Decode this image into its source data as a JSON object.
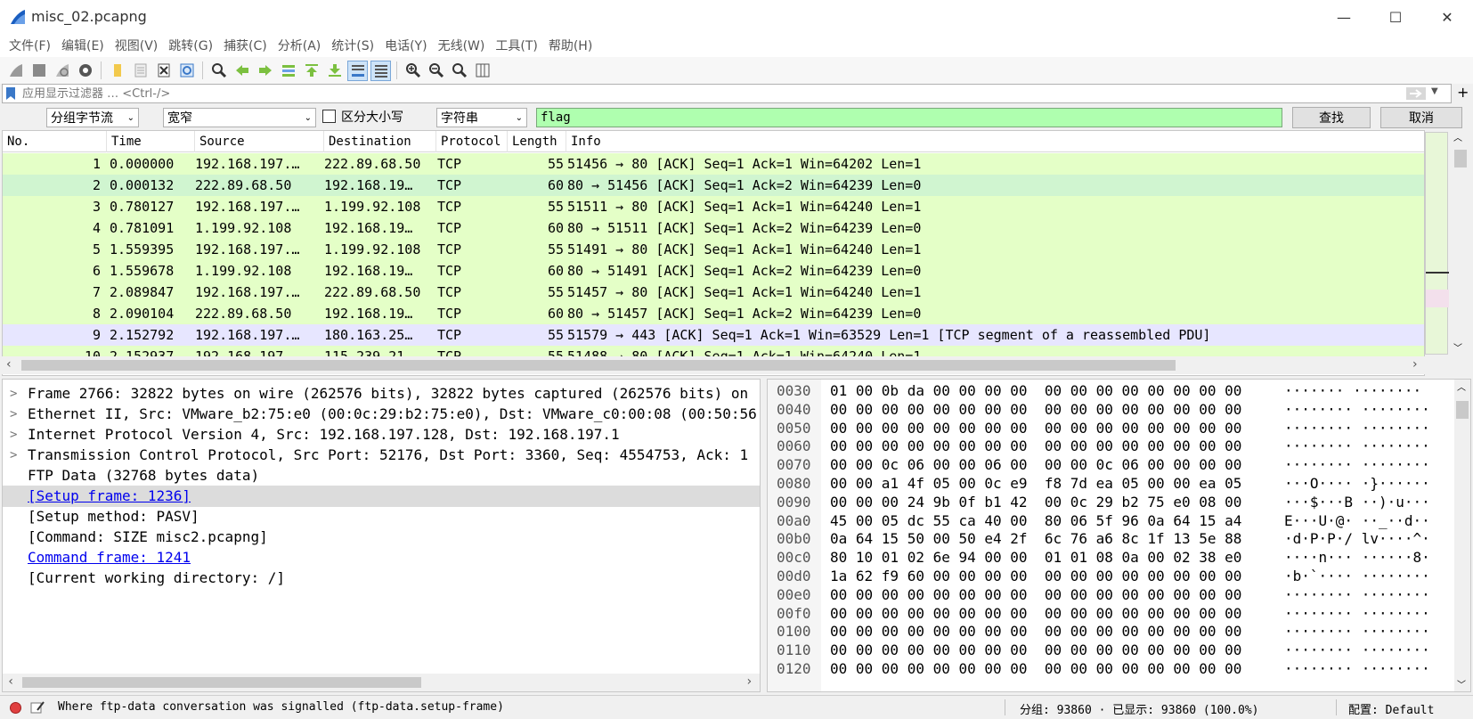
{
  "window": {
    "title": "misc_02.pcapng",
    "minimize_glyph": "—",
    "maximize_glyph": "☐",
    "close_glyph": "✕"
  },
  "menu": [
    "文件(F)",
    "编辑(E)",
    "视图(V)",
    "跳转(G)",
    "捕获(C)",
    "分析(A)",
    "统计(S)",
    "电话(Y)",
    "无线(W)",
    "工具(T)",
    "帮助(H)"
  ],
  "toolbar": {
    "icons": [
      "shark-fin-start-icon",
      "stop-square-icon",
      "restart-icon",
      "options-gear-icon",
      "open-folder-icon",
      "file-icon",
      "close-file-icon",
      "reload-icon",
      "find-magnifier-icon",
      "go-back-arrow-icon",
      "go-forward-arrow-icon",
      "go-to-packet-icon",
      "go-first-icon",
      "go-last-icon",
      "auto-scroll-icon",
      "colorize-icon",
      "zoom-in-icon",
      "zoom-out-icon",
      "zoom-normal-icon",
      "resize-columns-icon"
    ]
  },
  "display_filter": {
    "placeholder": "应用显示过滤器 … <Ctrl-/>",
    "value": ""
  },
  "find_bar": {
    "search_in": "分组字节流",
    "char_width": "宽窄",
    "case_sensitive_label": "区分大小写",
    "case_sensitive_checked": false,
    "search_type": "字符串",
    "search_value": "flag",
    "find_button": "查找",
    "cancel_button": "取消",
    "highlight_color": "#afffaf"
  },
  "packet_list": {
    "columns": [
      "No.",
      "Time",
      "Source",
      "Destination",
      "Protocol",
      "Length",
      "Info"
    ],
    "rows": [
      {
        "no": "1",
        "time": "0.000000",
        "src": "192.168.197.…",
        "dst": "222.89.68.50",
        "proto": "TCP",
        "len": "55",
        "info": "51456 → 80 [ACK] Seq=1 Ack=1 Win=64202 Len=1"
      },
      {
        "no": "2",
        "time": "0.000132",
        "src": "222.89.68.50",
        "dst": "192.168.19…",
        "proto": "TCP",
        "len": "60",
        "info": "80 → 51456 [ACK] Seq=1 Ack=2 Win=64239 Len=0"
      },
      {
        "no": "3",
        "time": "0.780127",
        "src": "192.168.197.…",
        "dst": "1.199.92.108",
        "proto": "TCP",
        "len": "55",
        "info": "51511 → 80 [ACK] Seq=1 Ack=1 Win=64240 Len=1"
      },
      {
        "no": "4",
        "time": "0.781091",
        "src": "1.199.92.108",
        "dst": "192.168.19…",
        "proto": "TCP",
        "len": "60",
        "info": "80 → 51511 [ACK] Seq=1 Ack=2 Win=64239 Len=0"
      },
      {
        "no": "5",
        "time": "1.559395",
        "src": "192.168.197.…",
        "dst": "1.199.92.108",
        "proto": "TCP",
        "len": "55",
        "info": "51491 → 80 [ACK] Seq=1 Ack=1 Win=64240 Len=1"
      },
      {
        "no": "6",
        "time": "1.559678",
        "src": "1.199.92.108",
        "dst": "192.168.19…",
        "proto": "TCP",
        "len": "60",
        "info": "80 → 51491 [ACK] Seq=1 Ack=2 Win=64239 Len=0"
      },
      {
        "no": "7",
        "time": "2.089847",
        "src": "192.168.197.…",
        "dst": "222.89.68.50",
        "proto": "TCP",
        "len": "55",
        "info": "51457 → 80 [ACK] Seq=1 Ack=1 Win=64240 Len=1"
      },
      {
        "no": "8",
        "time": "2.090104",
        "src": "222.89.68.50",
        "dst": "192.168.19…",
        "proto": "TCP",
        "len": "60",
        "info": "80 → 51457 [ACK] Seq=1 Ack=2 Win=64239 Len=0"
      },
      {
        "no": "9",
        "time": "2.152792",
        "src": "192.168.197.…",
        "dst": "180.163.25…",
        "proto": "TCP",
        "len": "55",
        "info": "51579 → 443 [ACK] Seq=1 Ack=1 Win=63529 Len=1 [TCP segment of a reassembled PDU]"
      },
      {
        "no": "10",
        "time": "2.152937",
        "src": "192.168.197.…",
        "dst": "115.239.21…",
        "proto": "TCP",
        "len": "55",
        "info": "51488 → 80 [ACK] Seq=1 Ack=1 Win=64240 Len=1"
      }
    ],
    "row_color": "#e4ffc7",
    "selected_row_color": "#e7e6ff"
  },
  "details": {
    "rows": [
      {
        "arrow": ">",
        "text": "Frame 2766: 32822 bytes on wire (262576 bits), 32822 bytes captured (262576 bits) on",
        "link": false
      },
      {
        "arrow": ">",
        "text": "Ethernet II, Src: VMware_b2:75:e0 (00:0c:29:b2:75:e0), Dst: VMware_c0:00:08 (00:50:56",
        "link": false
      },
      {
        "arrow": ">",
        "text": "Internet Protocol Version 4, Src: 192.168.197.128, Dst: 192.168.197.1",
        "link": false
      },
      {
        "arrow": ">",
        "text": "Transmission Control Protocol, Src Port: 52176, Dst Port: 3360, Seq: 4554753, Ack: 1",
        "link": false
      },
      {
        "arrow": "",
        "text": "FTP Data (32768 bytes data)",
        "link": false
      },
      {
        "arrow": "",
        "text": "[Setup frame: 1236]",
        "link": true
      },
      {
        "arrow": "",
        "text": "[Setup method: PASV]",
        "link": false
      },
      {
        "arrow": "",
        "text": "[Command: SIZE misc2.pcapng]",
        "link": false
      },
      {
        "arrow": "",
        "text": "Command frame: 1241",
        "link": true
      },
      {
        "arrow": "",
        "text": "[Current working directory: /]",
        "link": false
      }
    ]
  },
  "bytes": {
    "rows": [
      {
        "off": "0030",
        "hex": "01 00 0b da 00 00 00 00  00 00 00 00 00 00 00 00",
        "ascii": "······· ········"
      },
      {
        "off": "0040",
        "hex": "00 00 00 00 00 00 00 00  00 00 00 00 00 00 00 00",
        "ascii": "········ ········"
      },
      {
        "off": "0050",
        "hex": "00 00 00 00 00 00 00 00  00 00 00 00 00 00 00 00",
        "ascii": "········ ········"
      },
      {
        "off": "0060",
        "hex": "00 00 00 00 00 00 00 00  00 00 00 00 00 00 00 00",
        "ascii": "········ ········"
      },
      {
        "off": "0070",
        "hex": "00 00 0c 06 00 00 06 00  00 00 0c 06 00 00 00 00",
        "ascii": "········ ········"
      },
      {
        "off": "0080",
        "hex": "00 00 a1 4f 05 00 0c e9  f8 7d ea 05 00 00 ea 05",
        "ascii": "···O···· ·}······"
      },
      {
        "off": "0090",
        "hex": "00 00 00 24 9b 0f b1 42  00 0c 29 b2 75 e0 08 00",
        "ascii": "···$···B ··)·u···"
      },
      {
        "off": "00a0",
        "hex": "45 00 05 dc 55 ca 40 00  80 06 5f 96 0a 64 15 a4",
        "ascii": "E···U·@· ··_··d··"
      },
      {
        "off": "00b0",
        "hex": "0a 64 15 50 00 50 e4 2f  6c 76 a6 8c 1f 13 5e 88",
        "ascii": "·d·P·P·/ lv····^·"
      },
      {
        "off": "00c0",
        "hex": "80 10 01 02 6e 94 00 00  01 01 08 0a 00 02 38 e0",
        "ascii": "····n··· ······8·"
      },
      {
        "off": "00d0",
        "hex": "1a 62 f9 60 00 00 00 00  00 00 00 00 00 00 00 00",
        "ascii": "·b·`···· ········"
      },
      {
        "off": "00e0",
        "hex": "00 00 00 00 00 00 00 00  00 00 00 00 00 00 00 00",
        "ascii": "········ ········"
      },
      {
        "off": "00f0",
        "hex": "00 00 00 00 00 00 00 00  00 00 00 00 00 00 00 00",
        "ascii": "········ ········"
      },
      {
        "off": "0100",
        "hex": "00 00 00 00 00 00 00 00  00 00 00 00 00 00 00 00",
        "ascii": "········ ········"
      },
      {
        "off": "0110",
        "hex": "00 00 00 00 00 00 00 00  00 00 00 00 00 00 00 00",
        "ascii": "········ ········"
      },
      {
        "off": "0120",
        "hex": "00 00 00 00 00 00 00 00  00 00 00 00 00 00 00 00",
        "ascii": "········ ········"
      }
    ]
  },
  "status": {
    "message": "Where ftp-data conversation was signalled (ftp-data.setup-frame)",
    "packets": "分组: 93860 · 已显示: 93860 (100.0%)",
    "profile": "配置: Default"
  }
}
